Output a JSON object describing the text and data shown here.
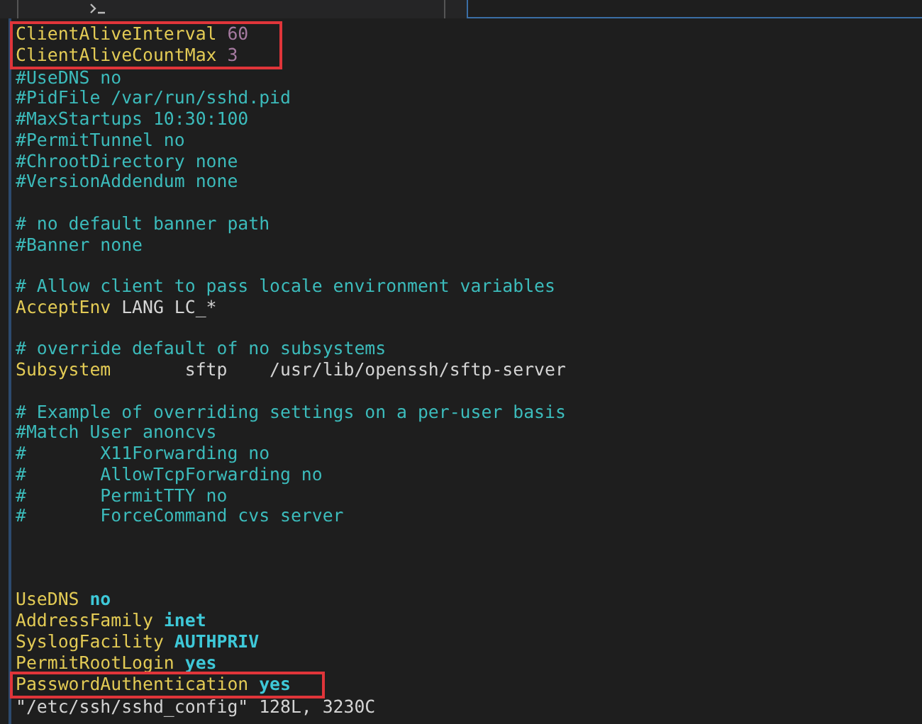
{
  "lines": [
    {
      "kind": "text",
      "boxed": true,
      "segments": [
        {
          "kind": "key",
          "text": "ClientAliveInterval"
        },
        {
          "kind": "number",
          "text": " 60"
        }
      ]
    },
    {
      "kind": "text",
      "boxed": true,
      "segments": [
        {
          "kind": "key",
          "text": "ClientAliveCountMax"
        },
        {
          "kind": "number",
          "text": " 3"
        }
      ]
    },
    {
      "kind": "text",
      "boxed": false,
      "segments": [
        {
          "kind": "comment",
          "text": "#UseDNS no"
        }
      ]
    },
    {
      "kind": "text",
      "boxed": false,
      "segments": [
        {
          "kind": "comment",
          "text": "#PidFile /var/run/sshd.pid"
        }
      ]
    },
    {
      "kind": "text",
      "boxed": false,
      "segments": [
        {
          "kind": "comment",
          "text": "#MaxStartups 10:30:100"
        }
      ]
    },
    {
      "kind": "text",
      "boxed": false,
      "segments": [
        {
          "kind": "comment",
          "text": "#PermitTunnel no"
        }
      ]
    },
    {
      "kind": "text",
      "boxed": false,
      "segments": [
        {
          "kind": "comment",
          "text": "#ChrootDirectory none"
        }
      ]
    },
    {
      "kind": "text",
      "boxed": false,
      "segments": [
        {
          "kind": "comment",
          "text": "#VersionAddendum none"
        }
      ]
    },
    {
      "kind": "blank"
    },
    {
      "kind": "text",
      "boxed": false,
      "segments": [
        {
          "kind": "comment",
          "text": "# no default banner path"
        }
      ]
    },
    {
      "kind": "text",
      "boxed": false,
      "segments": [
        {
          "kind": "comment",
          "text": "#Banner none"
        }
      ]
    },
    {
      "kind": "blank"
    },
    {
      "kind": "text",
      "boxed": false,
      "segments": [
        {
          "kind": "comment",
          "text": "# Allow client to pass locale environment variables"
        }
      ]
    },
    {
      "kind": "text",
      "boxed": false,
      "segments": [
        {
          "kind": "key",
          "text": "AcceptEnv"
        },
        {
          "kind": "plain",
          "text": " LANG LC_*"
        }
      ]
    },
    {
      "kind": "blank"
    },
    {
      "kind": "text",
      "boxed": false,
      "segments": [
        {
          "kind": "comment",
          "text": "# override default of no subsystems"
        }
      ]
    },
    {
      "kind": "text",
      "boxed": false,
      "segments": [
        {
          "kind": "key",
          "text": "Subsystem"
        },
        {
          "kind": "plain",
          "text": "       sftp    /usr/lib/openssh/sftp-server"
        }
      ]
    },
    {
      "kind": "blank"
    },
    {
      "kind": "text",
      "boxed": false,
      "segments": [
        {
          "kind": "comment",
          "text": "# Example of overriding settings on a per-user basis"
        }
      ]
    },
    {
      "kind": "text",
      "boxed": false,
      "segments": [
        {
          "kind": "comment",
          "text": "#Match User anoncvs"
        }
      ]
    },
    {
      "kind": "text",
      "boxed": false,
      "segments": [
        {
          "kind": "comment",
          "text": "#       X11Forwarding no"
        }
      ]
    },
    {
      "kind": "text",
      "boxed": false,
      "segments": [
        {
          "kind": "comment",
          "text": "#       AllowTcpForwarding no"
        }
      ]
    },
    {
      "kind": "text",
      "boxed": false,
      "segments": [
        {
          "kind": "comment",
          "text": "#       PermitTTY no"
        }
      ]
    },
    {
      "kind": "text",
      "boxed": false,
      "segments": [
        {
          "kind": "comment",
          "text": "#       ForceCommand cvs server"
        }
      ]
    },
    {
      "kind": "blank"
    },
    {
      "kind": "blank"
    },
    {
      "kind": "blank"
    },
    {
      "kind": "text",
      "boxed": false,
      "segments": [
        {
          "kind": "key",
          "text": "UseDNS"
        },
        {
          "kind": "keyword",
          "text": " no"
        }
      ]
    },
    {
      "kind": "text",
      "boxed": false,
      "segments": [
        {
          "kind": "key",
          "text": "AddressFamily"
        },
        {
          "kind": "keyword",
          "text": " inet"
        }
      ]
    },
    {
      "kind": "text",
      "boxed": false,
      "segments": [
        {
          "kind": "key",
          "text": "SyslogFacility"
        },
        {
          "kind": "keyword",
          "text": " AUTHPRIV"
        }
      ]
    },
    {
      "kind": "text",
      "boxed": false,
      "segments": [
        {
          "kind": "key",
          "text": "PermitRootLogin"
        },
        {
          "kind": "keyword",
          "text": " yes"
        }
      ]
    },
    {
      "kind": "text",
      "boxed": true,
      "segments": [
        {
          "kind": "key",
          "text": "PasswordAuthentication"
        },
        {
          "kind": "keyword",
          "text": " yes"
        }
      ]
    }
  ],
  "status_line": "\"/etc/ssh/sshd_config\" 128L, 3230C"
}
